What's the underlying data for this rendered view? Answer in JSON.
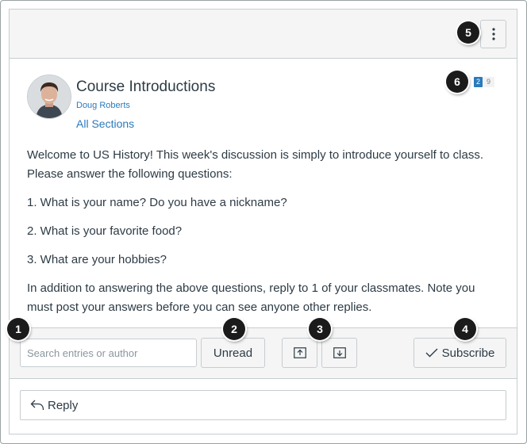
{
  "header": {
    "menu_icon": "vertical-ellipsis-icon"
  },
  "topic": {
    "title": "Course Introductions",
    "author": "Doug Roberts",
    "sections": "All Sections",
    "unread_count": "2",
    "total_count": "9",
    "avatar_icon": "user-avatar-photo"
  },
  "body": {
    "paragraphs": [
      "Welcome to US History! This week's discussion is simply to introduce yourself to class. Please answer the following questions:",
      "1. What is your name? Do you have a nickname?",
      "2. What is your favorite food?",
      "3. What are your hobbies?",
      "In addition to answering the above questions, reply to 1 of your classmates. Note you must post your answers before you can see anyone other replies."
    ]
  },
  "toolbar": {
    "search_placeholder": "Search entries or author",
    "search_value": "",
    "unread_label": "Unread",
    "expand_icon": "arrow-up-box-icon",
    "collapse_icon": "arrow-down-box-icon",
    "subscribe_label": "Subscribe",
    "subscribe_icon": "checkmark-icon"
  },
  "reply": {
    "label": "Reply",
    "icon": "reply-arrow-icon"
  },
  "markers": [
    "1",
    "2",
    "3",
    "4",
    "5",
    "6"
  ],
  "colors": {
    "link": "#2b7abc",
    "badge_unread": "#2b7abc",
    "toolbar_bg": "#f5f5f5",
    "marker_bg": "#1b1b1b"
  }
}
